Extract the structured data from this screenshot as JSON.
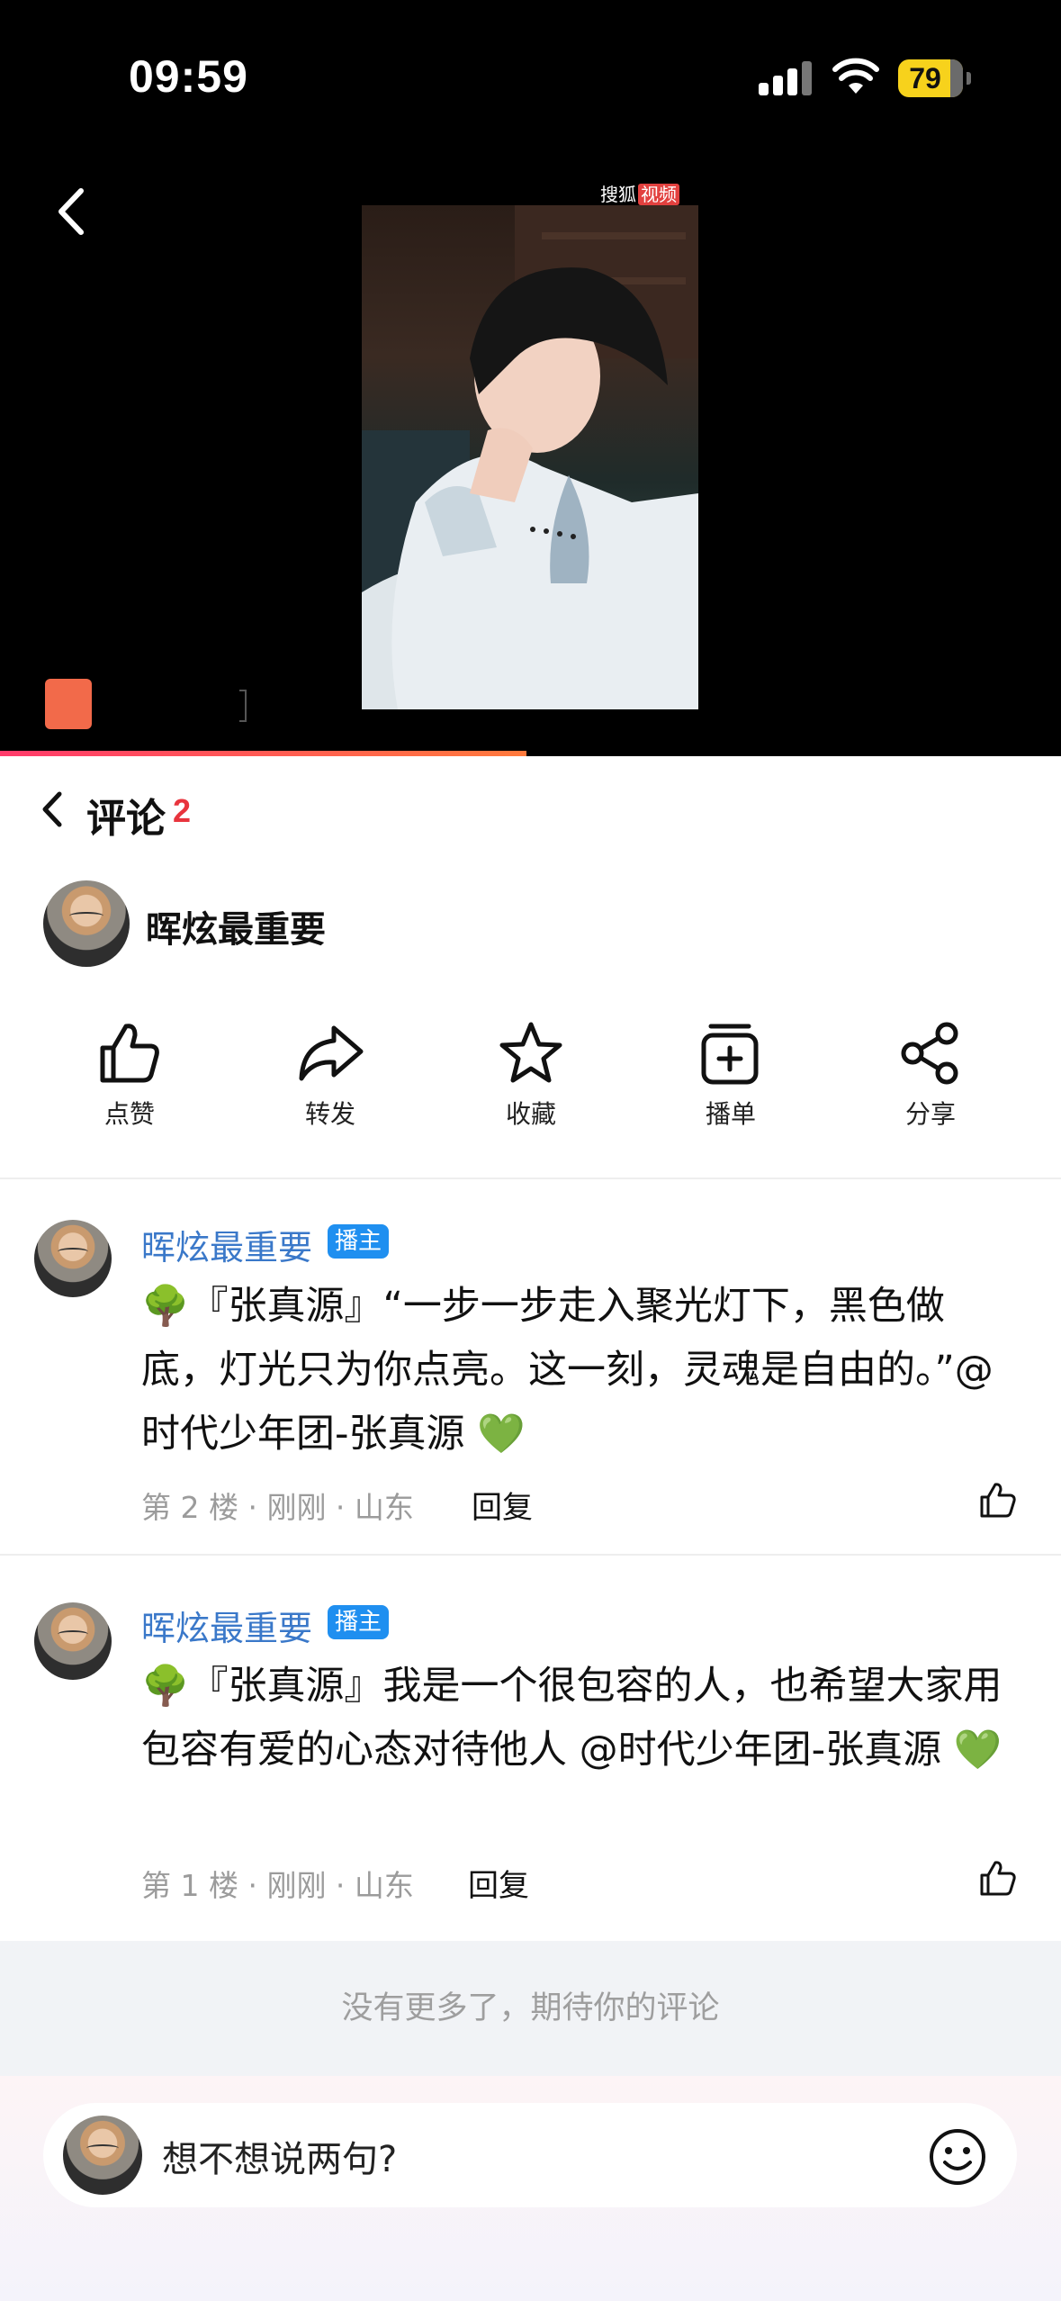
{
  "status_bar": {
    "time": "09:59",
    "battery": "79"
  },
  "video": {
    "watermark_brand": "搜狐",
    "watermark_tag": "视频",
    "progress": 0.496
  },
  "comments_header": {
    "title": "评论",
    "count": "2"
  },
  "author": {
    "name": "晖炫最重要"
  },
  "actions": [
    {
      "label": "点赞",
      "icon": "thumb-up-icon"
    },
    {
      "label": "转发",
      "icon": "forward-icon"
    },
    {
      "label": "收藏",
      "icon": "star-icon"
    },
    {
      "label": "播单",
      "icon": "playlist-add-icon"
    },
    {
      "label": "分享",
      "icon": "share-icon"
    }
  ],
  "comments": [
    {
      "name": "晖炫最重要",
      "badge": "播主",
      "text": "🌳『张真源』“一步一步走入聚光灯下，黑色做底，灯光只为你点亮。这一刻，灵魂是自由的。”@时代少年团-张真源 💚",
      "meta": "第 2 楼 · 刚刚 · 山东",
      "reply": "回复"
    },
    {
      "name": "晖炫最重要",
      "badge": "播主",
      "text": "🌳『张真源』我是一个很包容的人，也希望大家用包容有爱的心态对待他人 @时代少年团-张真源 💚",
      "meta": "第 1 楼 · 刚刚 · 山东",
      "reply": "回复"
    }
  ],
  "no_more_text": "没有更多了，期待你的评论",
  "input": {
    "placeholder": "想不想说两句?"
  },
  "colors": {
    "accent_red": "#e8343d",
    "link_blue": "#3a78c9",
    "badge_blue": "#1f8ff0",
    "battery_yellow": "#f7d21c"
  }
}
